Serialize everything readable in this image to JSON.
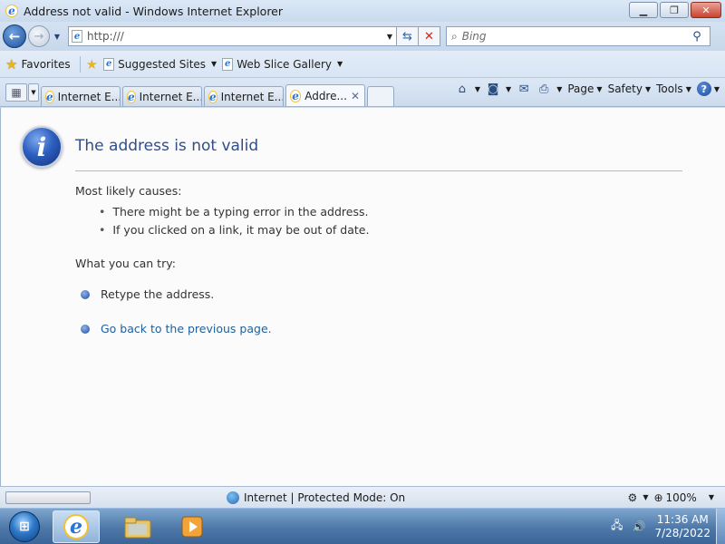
{
  "window": {
    "title": "Address not valid - Windows Internet Explorer",
    "min_label": "▁",
    "max_label": "❐",
    "close_label": "✕"
  },
  "address_bar": {
    "url": "http:///",
    "search_placeholder": "Bing"
  },
  "favorites_bar": {
    "favorites_label": "Favorites",
    "links": [
      {
        "label": "Suggested Sites"
      },
      {
        "label": "Web Slice Gallery"
      }
    ]
  },
  "tabs": [
    {
      "label": "Internet E..."
    },
    {
      "label": "Internet E..."
    },
    {
      "label": "Internet E..."
    },
    {
      "label": "Addre...",
      "active": true
    }
  ],
  "command_bar": {
    "page": "Page",
    "safety": "Safety",
    "tools": "Tools"
  },
  "content": {
    "heading": "The address is not valid",
    "causes_heading": "Most likely causes:",
    "causes": [
      "There might be a typing error in the address.",
      "If you clicked on a link, it may be out of date."
    ],
    "try_heading": "What you can try:",
    "try_items": [
      {
        "text": "Retype the address.",
        "link": false
      },
      {
        "text": "Go back to the previous page.",
        "link": true
      }
    ]
  },
  "status_bar": {
    "zone": "Internet | Protected Mode: On",
    "zoom": "100%"
  },
  "taskbar": {
    "time": "11:36 AM",
    "date": "7/28/2022"
  },
  "colors": {
    "heading": "#2f4e8a",
    "link": "#1f5f99",
    "taskbar": "#4d78a8"
  }
}
